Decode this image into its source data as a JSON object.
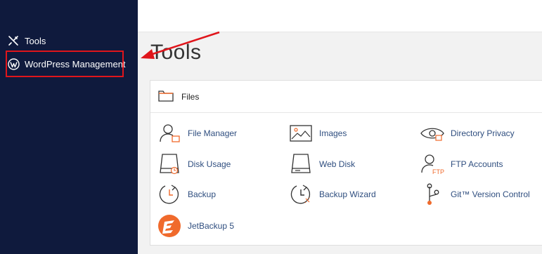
{
  "sidebar": {
    "items": [
      {
        "label": "Tools",
        "icon": "tools-icon"
      },
      {
        "label": "WordPress Management",
        "icon": "wordpress-icon"
      }
    ]
  },
  "main": {
    "title": "Tools",
    "panel": {
      "header": "Files",
      "tools": [
        {
          "label": "File Manager",
          "icon": "file-manager-icon"
        },
        {
          "label": "Images",
          "icon": "images-icon"
        },
        {
          "label": "Directory Privacy",
          "icon": "directory-privacy-icon"
        },
        {
          "label": "Disk Usage",
          "icon": "disk-usage-icon"
        },
        {
          "label": "Web Disk",
          "icon": "web-disk-icon"
        },
        {
          "label": "FTP Accounts",
          "icon": "ftp-accounts-icon"
        },
        {
          "label": "Backup",
          "icon": "backup-icon"
        },
        {
          "label": "Backup Wizard",
          "icon": "backup-wizard-icon"
        },
        {
          "label": "Git™ Version Control",
          "icon": "git-icon"
        },
        {
          "label": "JetBackup 5",
          "icon": "jetbackup-icon"
        }
      ]
    }
  },
  "colors": {
    "sidebar_bg": "#0f1a3d",
    "accent": "#f06a2c",
    "highlight": "#e0151b",
    "link": "#2f4e7f"
  }
}
